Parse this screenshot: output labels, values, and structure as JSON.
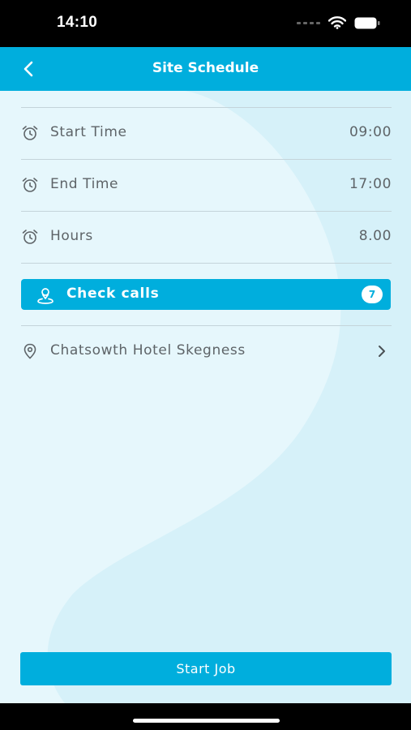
{
  "status_bar": {
    "time": "14:10"
  },
  "header": {
    "title": "Site Schedule"
  },
  "schedule": {
    "rows": [
      {
        "label": "Start Time",
        "value": "09:00",
        "icon": "alarm-clock-icon"
      },
      {
        "label": "End Time",
        "value": "17:00",
        "icon": "alarm-clock-icon"
      },
      {
        "label": "Hours",
        "value": "8.00",
        "icon": "alarm-clock-icon"
      }
    ]
  },
  "check_calls": {
    "label": "Check calls",
    "count": "7",
    "icon": "person-pin-icon"
  },
  "site": {
    "name": "Chatsowth Hotel Skegness",
    "icon": "location-pin-icon"
  },
  "actions": {
    "start_job": "Start Job"
  },
  "colors": {
    "accent": "#00AEDD",
    "background": "#E6F7FC",
    "text": "#5E6468"
  }
}
